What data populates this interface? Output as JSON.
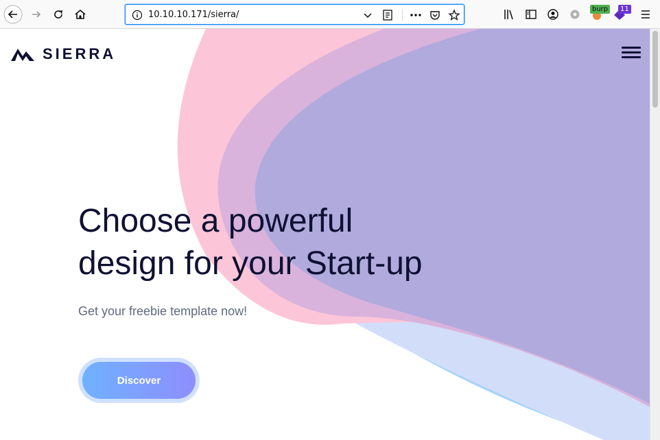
{
  "browser": {
    "url": "10.10.10.171/sierra/",
    "burp_badge": "burp",
    "extension_badge_count": "11"
  },
  "site": {
    "brand_name": "SIERRA",
    "hero_title_line1": "Choose a powerful",
    "hero_title_line2": "design for your Start-up",
    "hero_subtitle": "Get your freebie template now!",
    "cta_label": "Discover"
  },
  "colors": {
    "wave_pink": "#fdc5d8",
    "wave_mauve": "#d9b3dc",
    "wave_purple": "#b1aadc",
    "wave_light_blue": "#d2def9",
    "wave_blue": "#a5d4fc",
    "text_dark": "#0e1133",
    "text_muted": "#5e6a80"
  }
}
